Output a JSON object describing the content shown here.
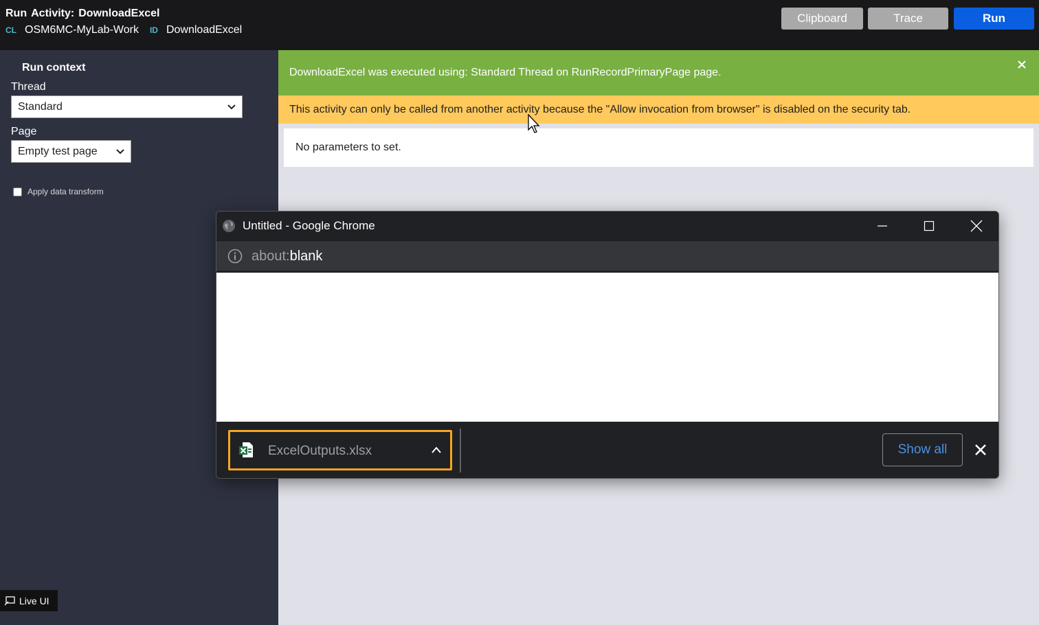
{
  "header": {
    "run_label": "Run",
    "activity_label": "Activity:",
    "activity_name": "DownloadExcel",
    "cl_key": "CL",
    "cl_value": "OSM6MC-MyLab-Work",
    "id_key": "ID",
    "id_value": "DownloadExcel",
    "buttons": {
      "clipboard": "Clipboard",
      "trace": "Trace",
      "run": "Run"
    }
  },
  "run_context": {
    "title": "Run context",
    "thread_label": "Thread",
    "thread_value": "Standard",
    "page_label": "Page",
    "page_value": "Empty test page",
    "apply_transform_label": "Apply data transform",
    "apply_transform_checked": false
  },
  "live_ui": {
    "label": "Live UI"
  },
  "banners": {
    "success": "DownloadExcel was executed using: Standard Thread on RunRecordPrimaryPage page.",
    "warning": "This activity can only be called from another activity because the \"Allow invocation from browser\" is disabled on the security tab."
  },
  "params": {
    "message": "No parameters to set."
  },
  "chrome": {
    "window_title": "Untitled - Google Chrome",
    "url_scheme": "about:",
    "url_host": "blank",
    "download": {
      "file_name": "ExcelOutputs.xlsx"
    },
    "show_all_label": "Show all"
  },
  "colors": {
    "success_banner": "#78b042",
    "warning_banner": "#ffc95c",
    "run_button": "#0a5fe0",
    "download_highlight": "#f5a623",
    "link_blue": "#4a90e2"
  },
  "icons": [
    "globe-icon",
    "minimize-icon",
    "maximize-icon",
    "close-icon",
    "info-icon",
    "excel-file-icon",
    "chevron-up-icon",
    "chevron-down-icon",
    "live-ui-icon",
    "mouse-cursor-icon"
  ]
}
